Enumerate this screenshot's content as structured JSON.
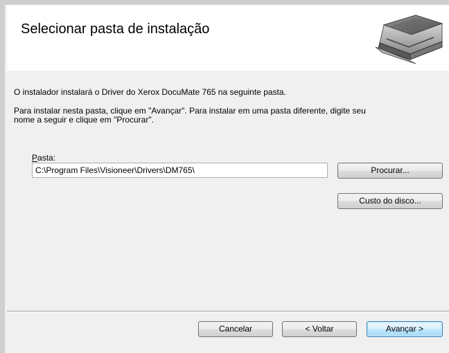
{
  "header": {
    "title": "Selecionar pasta de instalação",
    "graphic": "scanner-image"
  },
  "body": {
    "line1": "O instalador instalará o Driver do Xerox DocuMate 765 na seguinte pasta.",
    "line2": "Para instalar nesta pasta, clique em \"Avançar\". Para instalar em uma pasta diferente, digite seu",
    "line3": "nome a seguir e clique em \"Procurar\".",
    "folder_label_accel": "P",
    "folder_label_rest": "asta:",
    "folder_value": "C:\\Program Files\\Visioneer\\Drivers\\DM765\\"
  },
  "buttons": {
    "browse": "Procurar...",
    "disk_cost": "Custo do disco...",
    "cancel": "Cancelar",
    "back": "< Voltar",
    "next": "Avançar >"
  }
}
